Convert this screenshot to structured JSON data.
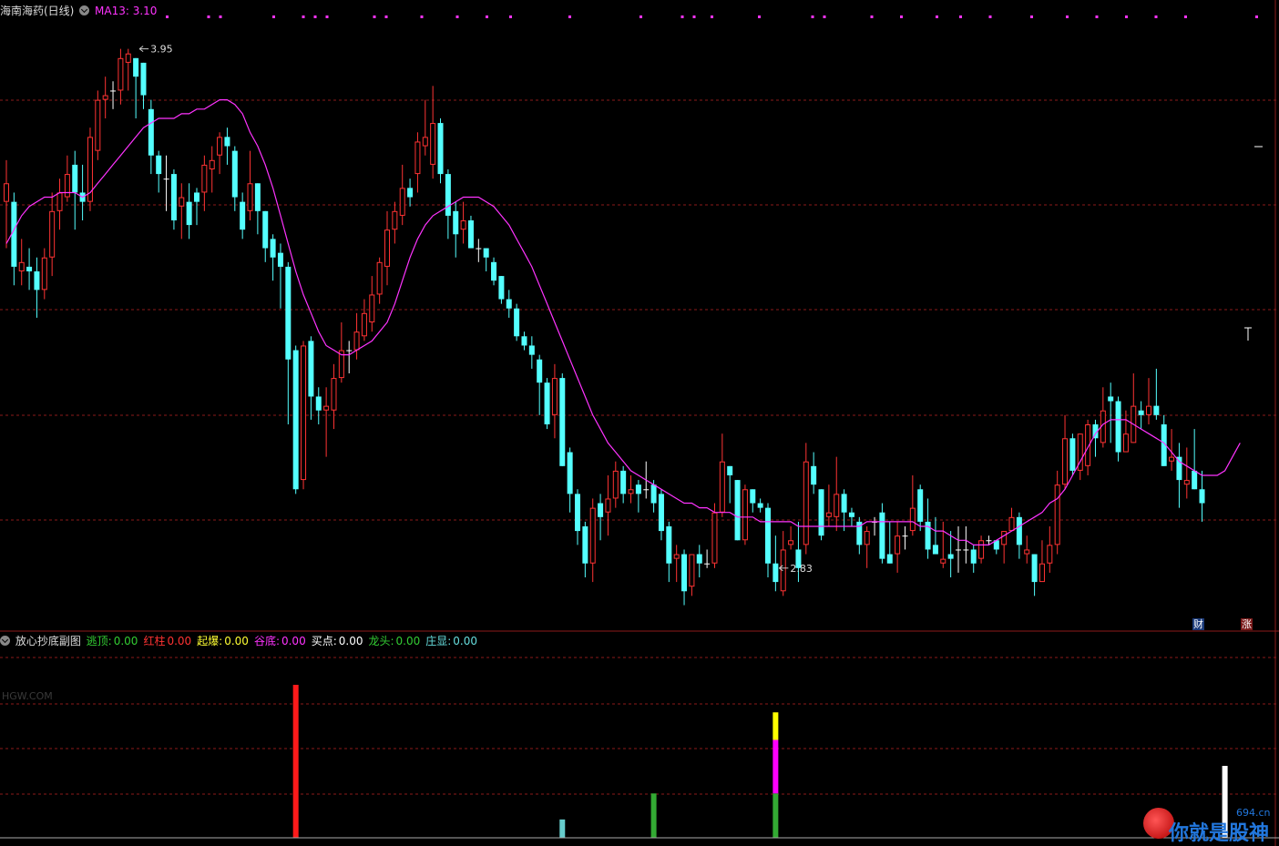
{
  "header_main": {
    "stock_name": "海南海药(日线)",
    "ma_label": "MA13: 3.10",
    "ma_color": "#ff33ff"
  },
  "header_indicator": {
    "name": "放心抄底副图",
    "items": [
      {
        "label": "逃顶:",
        "value": "0.00",
        "color": "#33cc33"
      },
      {
        "label": "红柱",
        "value": "0.00",
        "color": "#ff3333"
      },
      {
        "label": "起爆:",
        "value": "0.00",
        "color": "#ffff33"
      },
      {
        "label": "谷底:",
        "value": "0.00",
        "color": "#ff33ff"
      },
      {
        "label": "买点:",
        "value": "0.00",
        "color": "#ffffff"
      },
      {
        "label": "龙头:",
        "value": "0.00",
        "color": "#33cc33"
      },
      {
        "label": "庄显:",
        "value": "0.00",
        "color": "#66dddd"
      }
    ]
  },
  "badges": {
    "cai": "财",
    "zhang": "涨"
  },
  "watermark": "HGW.COM",
  "logo": {
    "text": "你就是股神",
    "url": "694.cn"
  },
  "colors": {
    "up": "#ff3333",
    "down": "#54ffff",
    "flat": "#ffffff",
    "grid": "#8b1a1a",
    "ma": "#ff33ff"
  },
  "chart_data": [
    {
      "type": "candlestick",
      "panel": "main",
      "ylim": [
        2.7,
        4.02
      ],
      "annotations": [
        {
          "text": "3.95",
          "index": 17,
          "price": 3.95
        },
        {
          "text": "2.83",
          "index": 101,
          "price": 2.83
        }
      ],
      "ma13": [
        3.53,
        3.56,
        3.59,
        3.61,
        3.62,
        3.63,
        3.63,
        3.64,
        3.64,
        3.64,
        3.63,
        3.64,
        3.66,
        3.68,
        3.7,
        3.72,
        3.74,
        3.76,
        3.78,
        3.79,
        3.8,
        3.8,
        3.8,
        3.81,
        3.81,
        3.82,
        3.82,
        3.83,
        3.84,
        3.84,
        3.83,
        3.81,
        3.77,
        3.74,
        3.7,
        3.65,
        3.59,
        3.53,
        3.47,
        3.42,
        3.38,
        3.34,
        3.31,
        3.3,
        3.29,
        3.29,
        3.3,
        3.31,
        3.32,
        3.34,
        3.36,
        3.4,
        3.45,
        3.5,
        3.54,
        3.57,
        3.59,
        3.6,
        3.61,
        3.62,
        3.63,
        3.63,
        3.63,
        3.62,
        3.61,
        3.59,
        3.57,
        3.54,
        3.51,
        3.48,
        3.44,
        3.4,
        3.36,
        3.32,
        3.28,
        3.24,
        3.2,
        3.16,
        3.13,
        3.1,
        3.08,
        3.06,
        3.04,
        3.03,
        3.02,
        3.01,
        3.0,
        2.99,
        2.98,
        2.97,
        2.97,
        2.96,
        2.96,
        2.95,
        2.95,
        2.95,
        2.94,
        2.94,
        2.94,
        2.93,
        2.93,
        2.93,
        2.93,
        2.93,
        2.92,
        2.92,
        2.92,
        2.92,
        2.92,
        2.92,
        2.92,
        2.92,
        2.92,
        2.93,
        2.93,
        2.93,
        2.93,
        2.93,
        2.93,
        2.93,
        2.92,
        2.92,
        2.91,
        2.91,
        2.9,
        2.89,
        2.89,
        2.88,
        2.88,
        2.88,
        2.89,
        2.9,
        2.91,
        2.92,
        2.93,
        2.94,
        2.95,
        2.97,
        2.98,
        3.0,
        3.03,
        3.06,
        3.09,
        3.12,
        3.14,
        3.15,
        3.15,
        3.15,
        3.14,
        3.13,
        3.12,
        3.11,
        3.1,
        3.08,
        3.06,
        3.05,
        3.04,
        3.03,
        3.03,
        3.03,
        3.04,
        3.07,
        3.1
      ],
      "candles": [
        [
          3.62,
          3.66,
          3.71,
          3.52
        ],
        [
          3.62,
          3.48,
          3.64,
          3.44
        ],
        [
          3.47,
          3.49,
          3.54,
          3.44
        ],
        [
          3.48,
          3.47,
          3.52,
          3.43
        ],
        [
          3.47,
          3.43,
          3.5,
          3.37
        ],
        [
          3.43,
          3.5,
          3.52,
          3.41
        ],
        [
          3.5,
          3.6,
          3.64,
          3.46
        ],
        [
          3.6,
          3.64,
          3.67,
          3.56
        ],
        [
          3.63,
          3.68,
          3.72,
          3.62
        ],
        [
          3.7,
          3.64,
          3.73,
          3.56
        ],
        [
          3.64,
          3.62,
          3.7,
          3.58
        ],
        [
          3.62,
          3.76,
          3.78,
          3.6
        ],
        [
          3.73,
          3.84,
          3.86,
          3.71
        ],
        [
          3.84,
          3.85,
          3.89,
          3.8
        ],
        [
          3.86,
          3.86,
          3.88,
          3.82
        ],
        [
          3.86,
          3.93,
          3.95,
          3.83
        ],
        [
          3.92,
          3.94,
          3.95,
          3.86
        ],
        [
          3.93,
          3.89,
          3.93,
          3.8
        ],
        [
          3.92,
          3.85,
          3.92,
          3.82
        ],
        [
          3.82,
          3.72,
          3.84,
          3.68
        ],
        [
          3.72,
          3.68,
          3.73,
          3.64
        ],
        [
          3.67,
          3.67,
          3.72,
          3.6
        ],
        [
          3.68,
          3.58,
          3.69,
          3.56
        ],
        [
          3.61,
          3.63,
          3.66,
          3.54
        ],
        [
          3.62,
          3.57,
          3.66,
          3.54
        ],
        [
          3.64,
          3.62,
          3.65,
          3.57
        ],
        [
          3.64,
          3.7,
          3.72,
          3.6
        ],
        [
          3.69,
          3.71,
          3.74,
          3.64
        ],
        [
          3.72,
          3.76,
          3.77,
          3.68
        ],
        [
          3.76,
          3.74,
          3.78,
          3.7
        ],
        [
          3.73,
          3.63,
          3.74,
          3.6
        ],
        [
          3.62,
          3.56,
          3.64,
          3.54
        ],
        [
          3.6,
          3.66,
          3.73,
          3.58
        ],
        [
          3.66,
          3.6,
          3.66,
          3.55
        ],
        [
          3.6,
          3.52,
          3.6,
          3.49
        ],
        [
          3.54,
          3.5,
          3.55,
          3.45
        ],
        [
          3.51,
          3.48,
          3.53,
          3.39
        ],
        [
          3.48,
          3.28,
          3.49,
          3.14
        ],
        [
          3.3,
          3.0,
          3.31,
          2.99
        ],
        [
          3.02,
          3.31,
          3.32,
          3.0
        ],
        [
          3.32,
          3.2,
          3.33,
          3.15
        ],
        [
          3.2,
          3.17,
          3.22,
          3.14
        ],
        [
          3.17,
          3.18,
          3.22,
          3.07
        ],
        [
          3.17,
          3.24,
          3.27,
          3.13
        ],
        [
          3.24,
          3.3,
          3.36,
          3.23
        ],
        [
          3.3,
          3.3,
          3.32,
          3.25
        ],
        [
          3.3,
          3.34,
          3.38,
          3.28
        ],
        [
          3.33,
          3.38,
          3.41,
          3.32
        ],
        [
          3.36,
          3.42,
          3.46,
          3.34
        ],
        [
          3.42,
          3.49,
          3.5,
          3.4
        ],
        [
          3.48,
          3.56,
          3.6,
          3.44
        ],
        [
          3.56,
          3.6,
          3.62,
          3.53
        ],
        [
          3.59,
          3.65,
          3.7,
          3.57
        ],
        [
          3.65,
          3.63,
          3.67,
          3.61
        ],
        [
          3.68,
          3.75,
          3.77,
          3.64
        ],
        [
          3.74,
          3.76,
          3.84,
          3.72
        ],
        [
          3.7,
          3.79,
          3.87,
          3.67
        ],
        [
          3.79,
          3.68,
          3.8,
          3.66
        ],
        [
          3.68,
          3.59,
          3.69,
          3.54
        ],
        [
          3.6,
          3.55,
          3.62,
          3.5
        ],
        [
          3.56,
          3.58,
          3.62,
          3.53
        ],
        [
          3.58,
          3.52,
          3.59,
          3.52
        ],
        [
          3.52,
          3.52,
          3.54,
          3.49
        ],
        [
          3.52,
          3.5,
          3.52,
          3.47
        ],
        [
          3.49,
          3.45,
          3.5,
          3.44
        ],
        [
          3.46,
          3.41,
          3.46,
          3.4
        ],
        [
          3.41,
          3.39,
          3.43,
          3.37
        ],
        [
          3.39,
          3.33,
          3.4,
          3.32
        ],
        [
          3.33,
          3.31,
          3.34,
          3.3
        ],
        [
          3.31,
          3.29,
          3.33,
          3.26
        ],
        [
          3.28,
          3.23,
          3.29,
          3.16
        ],
        [
          3.23,
          3.14,
          3.24,
          3.13
        ],
        [
          3.16,
          3.24,
          3.27,
          3.11
        ],
        [
          3.24,
          3.05,
          3.25,
          3.05
        ],
        [
          3.08,
          2.99,
          3.09,
          2.95
        ],
        [
          2.99,
          2.91,
          3.0,
          2.88
        ],
        [
          2.92,
          2.84,
          2.93,
          2.81
        ],
        [
          2.84,
          2.96,
          2.98,
          2.8
        ],
        [
          2.97,
          2.94,
          2.99,
          2.89
        ],
        [
          2.95,
          2.98,
          3.03,
          2.9
        ],
        [
          2.98,
          3.04,
          3.06,
          2.96
        ],
        [
          3.04,
          2.99,
          3.05,
          2.97
        ],
        [
          2.99,
          3.0,
          3.03,
          2.97
        ],
        [
          3.01,
          2.99,
          3.02,
          2.95
        ],
        [
          3.0,
          3.0,
          3.06,
          2.98
        ],
        [
          3.01,
          2.97,
          3.02,
          2.95
        ],
        [
          2.99,
          2.91,
          3.0,
          2.89
        ],
        [
          2.92,
          2.84,
          2.93,
          2.8
        ],
        [
          2.85,
          2.86,
          2.88,
          2.8
        ],
        [
          2.86,
          2.78,
          2.87,
          2.75
        ],
        [
          2.79,
          2.86,
          2.86,
          2.77
        ],
        [
          2.86,
          2.84,
          2.88,
          2.81
        ],
        [
          2.84,
          2.84,
          2.87,
          2.83
        ],
        [
          2.84,
          2.95,
          2.97,
          2.83
        ],
        [
          2.95,
          3.06,
          3.12,
          2.94
        ],
        [
          3.05,
          3.03,
          3.05,
          2.97
        ],
        [
          3.02,
          2.89,
          3.02,
          2.89
        ],
        [
          2.89,
          3.0,
          3.01,
          2.88
        ],
        [
          3.0,
          2.97,
          3.0,
          2.95
        ],
        [
          2.97,
          2.96,
          2.98,
          2.95
        ],
        [
          2.96,
          2.84,
          2.97,
          2.81
        ],
        [
          2.84,
          2.8,
          2.9,
          2.78
        ],
        [
          2.78,
          2.87,
          2.91,
          2.77
        ],
        [
          2.88,
          2.89,
          2.92,
          2.87
        ],
        [
          2.87,
          2.83,
          2.93,
          2.8
        ],
        [
          2.88,
          3.06,
          3.1,
          2.86
        ],
        [
          3.05,
          3.01,
          3.08,
          2.99
        ],
        [
          3.0,
          2.9,
          3.0,
          2.89
        ],
        [
          2.94,
          2.95,
          3.01,
          2.92
        ],
        [
          2.94,
          2.99,
          3.07,
          2.91
        ],
        [
          2.99,
          2.95,
          3.0,
          2.91
        ],
        [
          2.95,
          2.94,
          2.96,
          2.92
        ],
        [
          2.93,
          2.88,
          2.94,
          2.86
        ],
        [
          2.88,
          2.91,
          2.92,
          2.83
        ],
        [
          2.93,
          2.93,
          2.94,
          2.9
        ],
        [
          2.95,
          2.85,
          2.97,
          2.84
        ],
        [
          2.86,
          2.84,
          2.93,
          2.84
        ],
        [
          2.86,
          2.9,
          2.93,
          2.82
        ],
        [
          2.9,
          2.9,
          2.92,
          2.87
        ],
        [
          2.91,
          2.96,
          3.03,
          2.9
        ],
        [
          3.0,
          2.93,
          3.01,
          2.91
        ],
        [
          2.93,
          2.87,
          2.98,
          2.85
        ],
        [
          2.88,
          2.86,
          2.94,
          2.87
        ],
        [
          2.84,
          2.85,
          2.93,
          2.83
        ],
        [
          2.86,
          2.85,
          2.91,
          2.81
        ],
        [
          2.87,
          2.87,
          2.92,
          2.82
        ],
        [
          2.87,
          2.87,
          2.92,
          2.84
        ],
        [
          2.87,
          2.84,
          2.88,
          2.82
        ],
        [
          2.85,
          2.89,
          2.9,
          2.84
        ],
        [
          2.89,
          2.89,
          2.9,
          2.88
        ],
        [
          2.89,
          2.87,
          2.89,
          2.86
        ],
        [
          2.88,
          2.91,
          2.91,
          2.84
        ],
        [
          2.91,
          2.94,
          2.96,
          2.92
        ],
        [
          2.94,
          2.88,
          2.95,
          2.85
        ],
        [
          2.86,
          2.87,
          2.9,
          2.84
        ],
        [
          2.86,
          2.8,
          2.86,
          2.77
        ],
        [
          2.8,
          2.84,
          2.89,
          2.81
        ],
        [
          2.84,
          2.88,
          2.92,
          2.82
        ],
        [
          2.88,
          3.01,
          3.04,
          2.86
        ],
        [
          3.01,
          3.11,
          3.16,
          3.0
        ],
        [
          3.11,
          3.04,
          3.12,
          3.03
        ],
        [
          3.04,
          3.12,
          3.12,
          3.02
        ],
        [
          3.05,
          3.14,
          3.15,
          3.03
        ],
        [
          3.14,
          3.11,
          3.15,
          3.07
        ],
        [
          3.1,
          3.17,
          3.22,
          3.09
        ],
        [
          3.2,
          3.19,
          3.23,
          3.1
        ],
        [
          3.19,
          3.08,
          3.2,
          3.06
        ],
        [
          3.08,
          3.12,
          3.17,
          3.09
        ],
        [
          3.1,
          3.18,
          3.25,
          3.1
        ],
        [
          3.17,
          3.16,
          3.19,
          3.13
        ],
        [
          3.16,
          3.18,
          3.24,
          3.14
        ],
        [
          3.18,
          3.16,
          3.26,
          3.15
        ],
        [
          3.14,
          3.05,
          3.16,
          3.05
        ],
        [
          3.06,
          3.07,
          3.13,
          3.04
        ],
        [
          3.07,
          3.02,
          3.1,
          2.96
        ],
        [
          3.01,
          3.02,
          3.09,
          2.98
        ],
        [
          3.04,
          3.0,
          3.13,
          3.0
        ],
        [
          3.0,
          2.97,
          3.04,
          2.93
        ]
      ]
    },
    {
      "type": "bar",
      "panel": "indicator",
      "ylim": [
        0,
        1
      ],
      "series": [
        {
          "name": "红柱",
          "color": "#ff1a1a",
          "points": [
            {
              "index": 38,
              "value": 1.0
            }
          ]
        },
        {
          "name": "庄显",
          "color": "#66cccc",
          "points": [
            {
              "index": 73,
              "value": 0.12
            }
          ]
        },
        {
          "name": "龙头",
          "color": "#33aa33",
          "points": [
            {
              "index": 85,
              "value": 0.29
            },
            {
              "index": 101,
              "value": 0.29
            }
          ]
        },
        {
          "name": "谷底",
          "color": "#ff00ff",
          "points": [
            {
              "index": 101,
              "value": 0.35
            }
          ]
        },
        {
          "name": "起爆",
          "color": "#ffff00",
          "points": [
            {
              "index": 101,
              "value": 0.18
            }
          ]
        },
        {
          "name": "买点",
          "color": "#ffffff",
          "points": [
            {
              "index": 160,
              "value": 0.47
            }
          ]
        }
      ]
    }
  ]
}
